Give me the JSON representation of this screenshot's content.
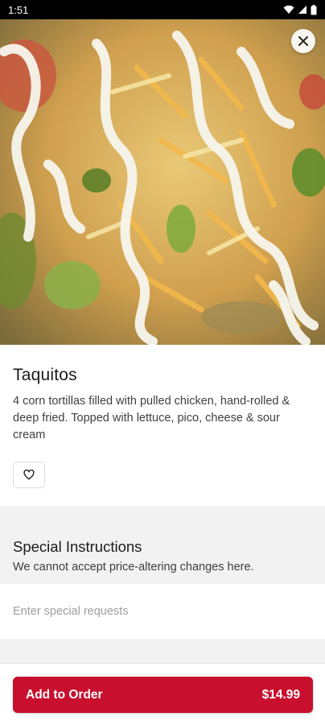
{
  "status_bar": {
    "time": "1:51"
  },
  "hero": {
    "image_subject": "taquitos-photo"
  },
  "item": {
    "title": "Taquitos",
    "description": "4 corn tortillas filled with pulled chicken, hand-rolled & deep fried. Topped with lettuce, pico, cheese & sour cream"
  },
  "special_instructions": {
    "title": "Special Instructions",
    "subtitle": "We cannot accept price-altering changes here.",
    "placeholder": "Enter special requests",
    "value": ""
  },
  "order": {
    "button_label": "Add to Order",
    "price": "$14.99"
  },
  "icons": {
    "close": "close-icon",
    "favorite": "heart-icon",
    "wifi": "wifi-icon",
    "signal": "signal-icon",
    "battery": "battery-icon"
  },
  "colors": {
    "accent": "#c8102e",
    "section_bg": "#f2f2f2",
    "status_bar": "#000000"
  }
}
